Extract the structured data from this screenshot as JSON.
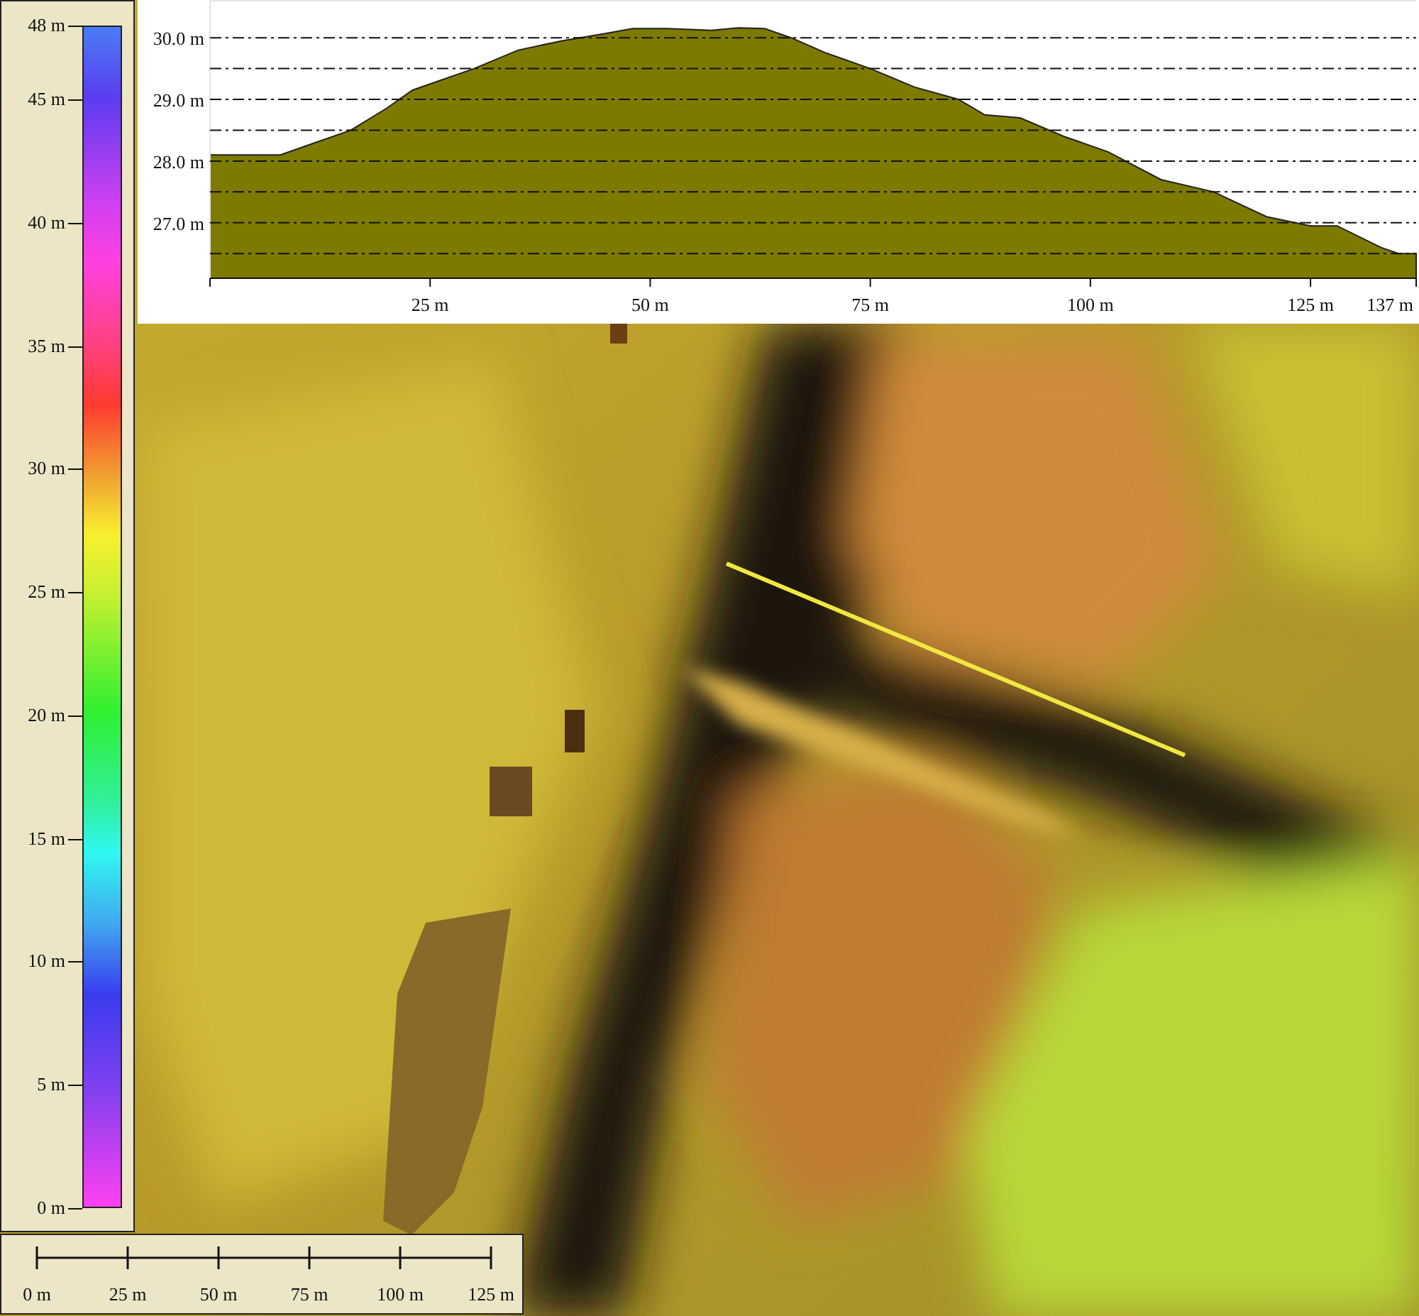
{
  "legend": {
    "labels": [
      "48 m",
      "45 m",
      "40 m",
      "35 m",
      "30 m",
      "25 m",
      "20 m",
      "15 m",
      "10 m",
      "5 m",
      "0 m"
    ]
  },
  "profile": {
    "chart_data": {
      "type": "area",
      "x": [
        0,
        8,
        12,
        16,
        20,
        23,
        30,
        35,
        40,
        45,
        48,
        52,
        57,
        60,
        63,
        66,
        70,
        75,
        80,
        85,
        88,
        92,
        97,
        102,
        108,
        114,
        120,
        125,
        128,
        133,
        135,
        137
      ],
      "series": [
        {
          "color": "#7d7a00",
          "values": [
            28.1,
            28.1,
            28.3,
            28.5,
            28.85,
            29.15,
            29.5,
            29.8,
            29.95,
            30.07,
            30.15,
            30.15,
            30.12,
            30.16,
            30.15,
            30.0,
            29.75,
            29.5,
            29.2,
            29.0,
            28.75,
            28.7,
            28.4,
            28.15,
            27.7,
            27.5,
            27.1,
            26.95,
            26.95,
            26.6,
            26.5,
            26.5
          ]
        }
      ],
      "xlim": [
        0,
        137
      ],
      "ylim": [
        26.1,
        30.6
      ],
      "grid": true,
      "xticks": [
        {
          "value": 25,
          "label": "25 m"
        },
        {
          "value": 50,
          "label": "50 m"
        },
        {
          "value": 75,
          "label": "75 m"
        },
        {
          "value": 100,
          "label": "100 m"
        },
        {
          "value": 125,
          "label": "125 m"
        },
        {
          "value": 137,
          "label": "137 m"
        }
      ],
      "yticks": [
        {
          "value": 27,
          "label": "27.0 m"
        },
        {
          "value": 28,
          "label": "28.0 m"
        },
        {
          "value": 29,
          "label": "29.0 m"
        },
        {
          "value": 30,
          "label": "30.0 m"
        }
      ]
    }
  },
  "scale_bar": {
    "labels": [
      "0 m",
      "25 m",
      "50 m",
      "75 m",
      "100 m",
      "125 m"
    ]
  }
}
